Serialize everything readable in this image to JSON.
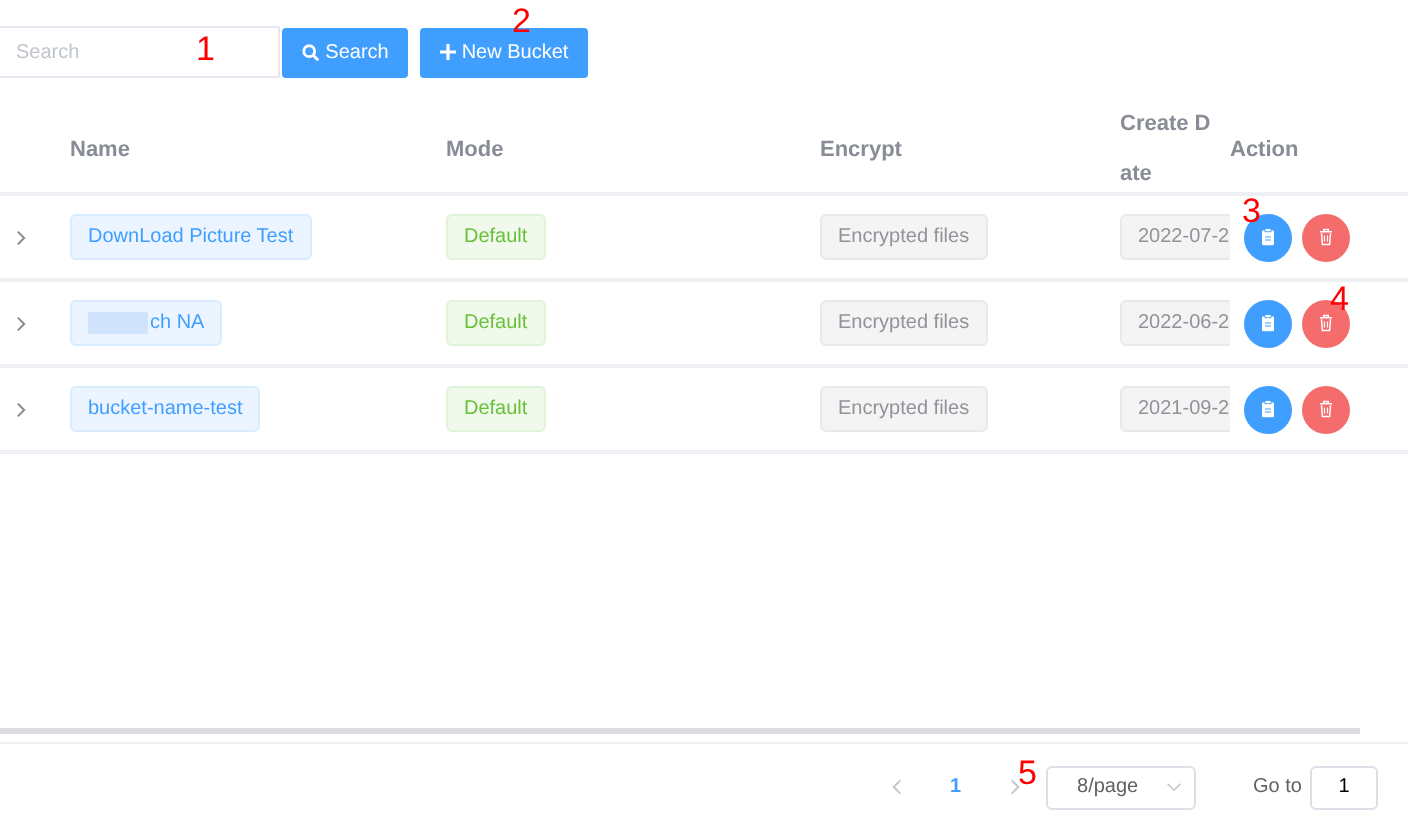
{
  "toolbar": {
    "search": {
      "placeholder": "Search"
    },
    "search_button": "Search",
    "new_button": "New Bucket"
  },
  "table": {
    "columns": [
      "Name",
      "Mode",
      "Encrypt",
      "Create Date",
      "Action"
    ],
    "rows": [
      {
        "expanded": false,
        "name": "DownLoad Picture Test",
        "name_blurred": false,
        "mode": "Default",
        "encrypt": "Encrypted files",
        "date": "2022-07-2"
      },
      {
        "expanded": false,
        "name": "ch NA",
        "name_blurred": true,
        "mode": "Default",
        "encrypt": "Encrypted files",
        "date": "2022-06-2"
      },
      {
        "expanded": false,
        "name": "bucket-name-test",
        "name_blurred": false,
        "mode": "Default",
        "encrypt": "Encrypted files",
        "date": "2021-09-2"
      }
    ]
  },
  "pagination": {
    "pages": [
      {
        "label": "1",
        "selected": true
      }
    ],
    "page_size": "8/page",
    "goto_label": "Go to",
    "goto_value": "1"
  },
  "annotations": [
    "1",
    "2",
    "3",
    "4",
    "5"
  ]
}
